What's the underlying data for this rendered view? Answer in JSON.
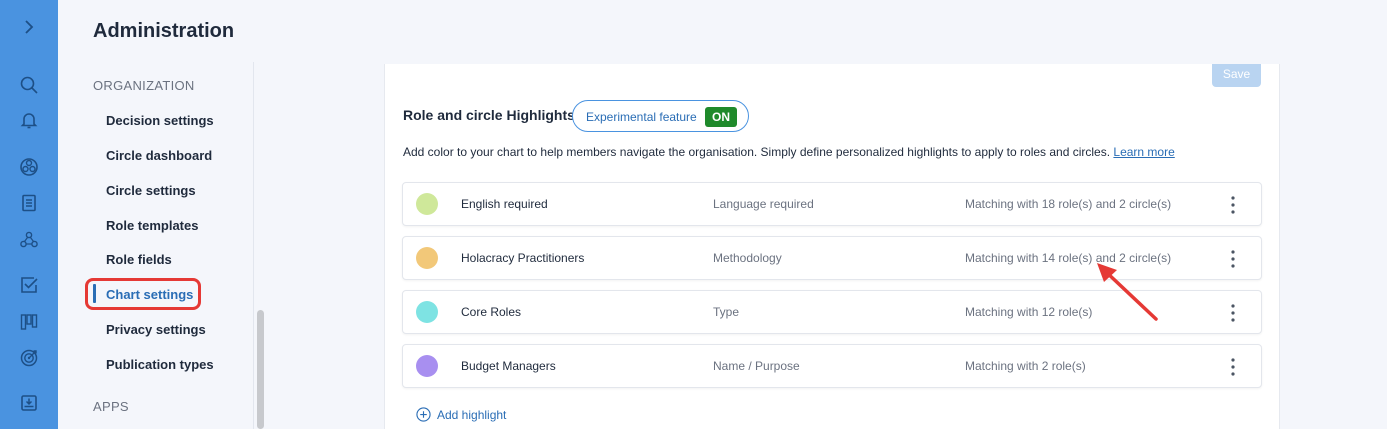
{
  "rail": {
    "icons": [
      "chevron-right-icon",
      "search-icon",
      "bell-icon",
      "globe-icon",
      "document-icon",
      "people-icon",
      "checkbox-icon",
      "board-icon",
      "target-icon",
      "inbox-icon"
    ]
  },
  "sidebar": {
    "title": "Administration",
    "section_org": "ORGANIZATION",
    "items": [
      {
        "label": "Decision settings"
      },
      {
        "label": "Circle dashboard"
      },
      {
        "label": "Circle settings"
      },
      {
        "label": "Role templates"
      },
      {
        "label": "Role fields"
      },
      {
        "label": "Chart settings",
        "active": true
      },
      {
        "label": "Privacy settings"
      },
      {
        "label": "Publication types"
      }
    ],
    "section_apps": "APPS"
  },
  "main": {
    "save_label": "Save",
    "title": "Role and circle Highlights",
    "experimental_label": "Experimental feature",
    "experimental_state": "ON",
    "description": "Add color to your chart to help members navigate the organisation. Simply define personalized highlights to apply to roles and circles.",
    "learn_more": "Learn more",
    "highlights": [
      {
        "name": "English required",
        "category": "Language required",
        "match": "Matching with 18 role(s) and 2 circle(s)",
        "color": "#cfe89a"
      },
      {
        "name": "Holacracy Practitioners",
        "category": "Methodology",
        "match": "Matching with 14 role(s) and 2 circle(s)",
        "color": "#f2c879"
      },
      {
        "name": "Core Roles",
        "category": "Type",
        "match": "Matching with 12 role(s)",
        "color": "#7ee3e3"
      },
      {
        "name": "Budget Managers",
        "category": "Name / Purpose",
        "match": "Matching with 2 role(s)",
        "color": "#a88ff0"
      }
    ],
    "add_highlight": "Add highlight"
  },
  "colors": {
    "rail": "#4a93e0",
    "accent": "#2a6db5",
    "on_badge": "#1f8a2b",
    "annotation": "#e53935"
  }
}
